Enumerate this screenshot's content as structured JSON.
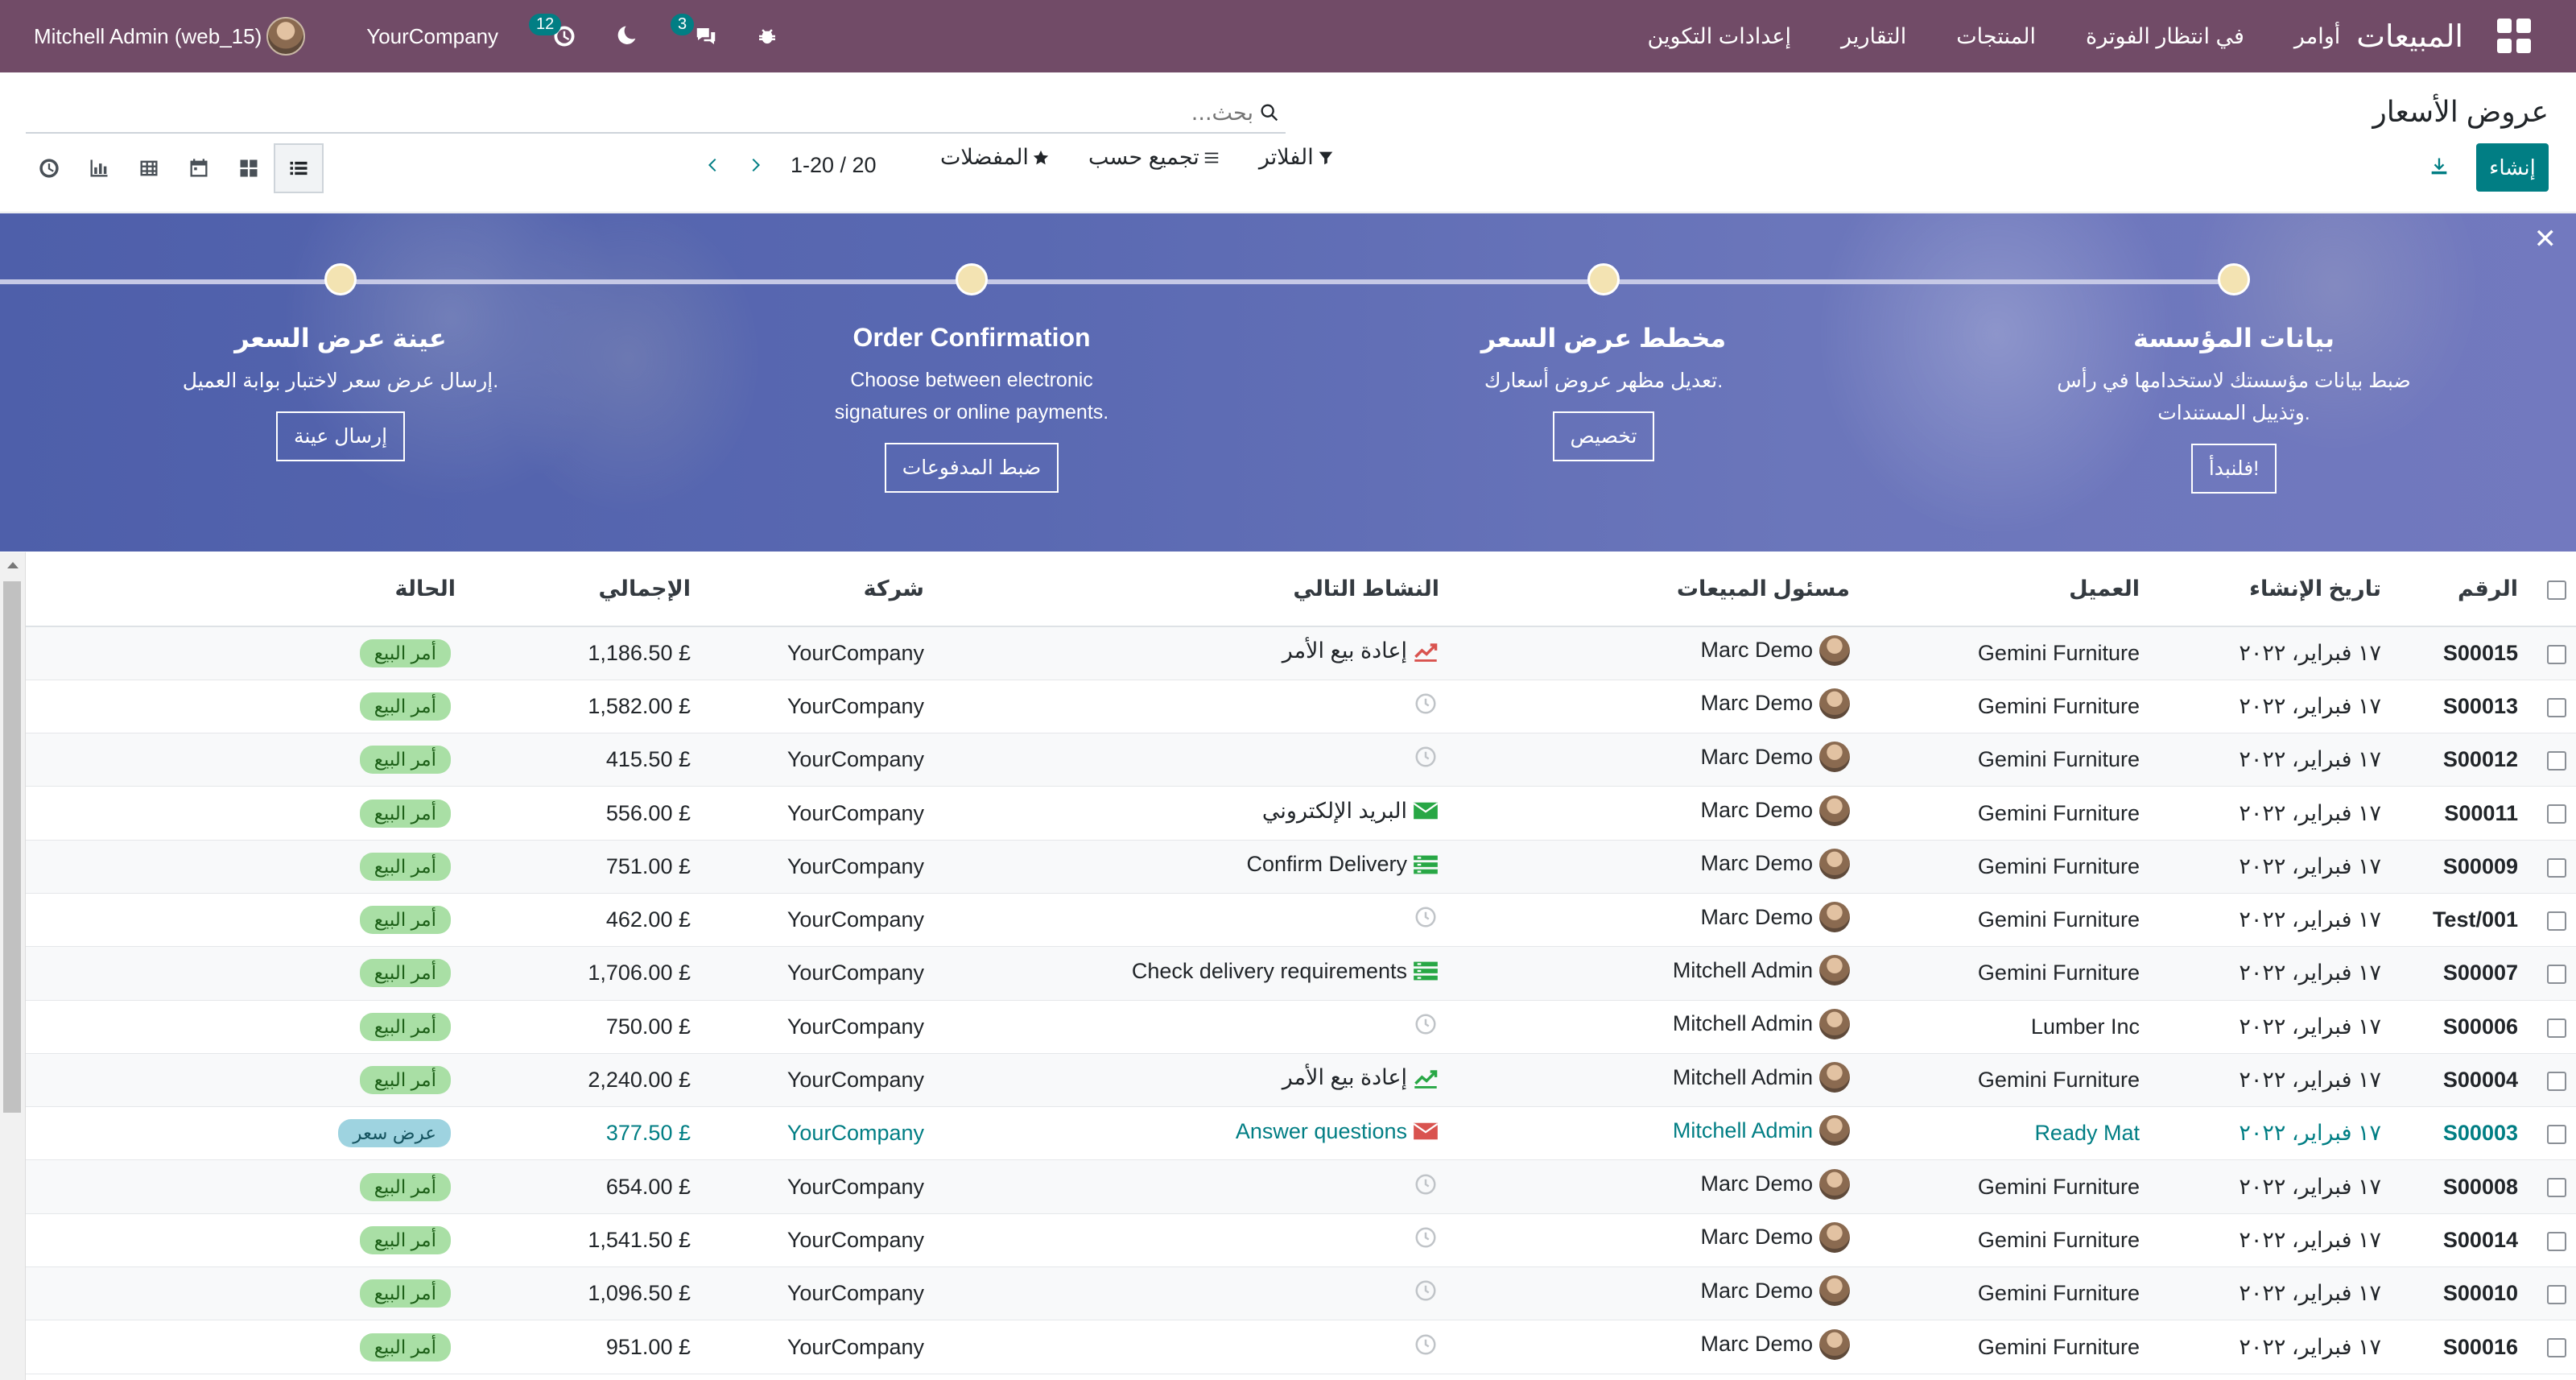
{
  "navbar": {
    "app_name": "المبيعات",
    "menu": [
      "أوامر",
      "في انتظار الفوترة",
      "المنتجات",
      "التقارير",
      "إعدادات التكوين"
    ],
    "user": "Mitchell Admin (web_15)",
    "company": "YourCompany",
    "activity_count": "12",
    "messages_count": "3"
  },
  "control_panel": {
    "title": "عروض الأسعار",
    "search_placeholder": "بحث...",
    "create_label": "إنشاء",
    "filters_label": "الفلاتر",
    "group_by_label": "تجميع حسب",
    "favorites_label": "المفضلات",
    "pager_value": "1-20 / 20"
  },
  "banner": {
    "steps": [
      {
        "title": "بيانات المؤسسة",
        "description": "ضبط بيانات مؤسستك لاستخدامها في رأس وتذييل المستندات.",
        "button": "فلنبدأ!"
      },
      {
        "title": "مخطط عرض السعر",
        "description": "تعديل مظهر عروض أسعارك.",
        "button": "تخصيص"
      },
      {
        "title": "Order Confirmation",
        "description": "Choose between electronic signatures or online payments.",
        "button": "ضبط المدفوعات"
      },
      {
        "title": "عينة عرض السعر",
        "description": "إرسال عرض سعر لاختبار بوابة العميل.",
        "button": "إرسال عينة"
      }
    ]
  },
  "table": {
    "columns": [
      "الرقم",
      "تاريخ الإنشاء",
      "العميل",
      "مسئول المبيعات",
      "النشاط التالي",
      "شركة",
      "الإجمالي",
      "الحالة"
    ],
    "rows": [
      {
        "ref": "S00015",
        "date": "١٧ فبراير، ٢٠٢٢",
        "customer": "Gemini Furniture",
        "salesperson": "Marc Demo",
        "activity": "إعادة بيع الأمر",
        "activity_icon": "upsell-icon",
        "company": "YourCompany",
        "total": "£ 1,186.50",
        "status": "أمر البيع"
      },
      {
        "ref": "S00013",
        "date": "١٧ فبراير، ٢٠٢٢",
        "customer": "Gemini Furniture",
        "salesperson": "Marc Demo",
        "activity": "",
        "activity_icon": "clock-icon",
        "company": "YourCompany",
        "total": "£ 1,582.00",
        "status": "أمر البيع"
      },
      {
        "ref": "S00012",
        "date": "١٧ فبراير، ٢٠٢٢",
        "customer": "Gemini Furniture",
        "salesperson": "Marc Demo",
        "activity": "",
        "activity_icon": "clock-icon",
        "company": "YourCompany",
        "total": "£ 415.50",
        "status": "أمر البيع"
      },
      {
        "ref": "S00011",
        "date": "١٧ فبراير، ٢٠٢٢",
        "customer": "Gemini Furniture",
        "salesperson": "Marc Demo",
        "activity": "البريد الإلكتروني",
        "activity_icon": "email-icon",
        "company": "YourCompany",
        "total": "£ 556.00",
        "status": "أمر البيع"
      },
      {
        "ref": "S00009",
        "date": "١٧ فبراير، ٢٠٢٢",
        "customer": "Gemini Furniture",
        "salesperson": "Marc Demo",
        "activity": "Confirm Delivery",
        "activity_icon": "todo-icon",
        "company": "YourCompany",
        "total": "£ 751.00",
        "status": "أمر البيع"
      },
      {
        "ref": "Test/001",
        "date": "١٧ فبراير، ٢٠٢٢",
        "customer": "Gemini Furniture",
        "salesperson": "Marc Demo",
        "activity": "",
        "activity_icon": "clock-icon",
        "company": "YourCompany",
        "total": "£ 462.00",
        "status": "أمر البيع"
      },
      {
        "ref": "S00007",
        "date": "١٧ فبراير، ٢٠٢٢",
        "customer": "Gemini Furniture",
        "salesperson": "Mitchell Admin",
        "activity": "Check delivery requirements",
        "activity_icon": "todo-icon",
        "company": "YourCompany",
        "total": "£ 1,706.00",
        "status": "أمر البيع"
      },
      {
        "ref": "S00006",
        "date": "١٧ فبراير، ٢٠٢٢",
        "customer": "Lumber Inc",
        "salesperson": "Mitchell Admin",
        "activity": "",
        "activity_icon": "clock-icon",
        "company": "YourCompany",
        "total": "£ 750.00",
        "status": "أمر البيع"
      },
      {
        "ref": "S00004",
        "date": "١٧ فبراير، ٢٠٢٢",
        "customer": "Gemini Furniture",
        "salesperson": "Mitchell Admin",
        "activity": "إعادة بيع الأمر",
        "activity_icon": "upsell-icon-green",
        "company": "YourCompany",
        "total": "£ 2,240.00",
        "status": "أمر البيع"
      },
      {
        "ref": "S00003",
        "date": "١٧ فبراير، ٢٠٢٢",
        "customer": "Ready Mat",
        "salesperson": "Mitchell Admin",
        "activity": "Answer questions",
        "activity_icon": "email-icon-red",
        "company": "YourCompany",
        "total": "£ 377.50",
        "status": "عرض سعر"
      },
      {
        "ref": "S00008",
        "date": "١٧ فبراير، ٢٠٢٢",
        "customer": "Gemini Furniture",
        "salesperson": "Marc Demo",
        "activity": "",
        "activity_icon": "clock-icon",
        "company": "YourCompany",
        "total": "£ 654.00",
        "status": "أمر البيع"
      },
      {
        "ref": "S00014",
        "date": "١٧ فبراير، ٢٠٢٢",
        "customer": "Gemini Furniture",
        "salesperson": "Marc Demo",
        "activity": "",
        "activity_icon": "clock-icon",
        "company": "YourCompany",
        "total": "£ 1,541.50",
        "status": "أمر البيع"
      },
      {
        "ref": "S00010",
        "date": "١٧ فبراير، ٢٠٢٢",
        "customer": "Gemini Furniture",
        "salesperson": "Marc Demo",
        "activity": "",
        "activity_icon": "clock-icon",
        "company": "YourCompany",
        "total": "£ 1,096.50",
        "status": "أمر البيع"
      },
      {
        "ref": "S00016",
        "date": "١٧ فبراير، ٢٠٢٢",
        "customer": "Gemini Furniture",
        "salesperson": "Marc Demo",
        "activity": "",
        "activity_icon": "clock-icon",
        "company": "YourCompany",
        "total": "£ 951.00",
        "status": "أمر البيع"
      }
    ]
  },
  "colors": {
    "navbar": "#714b67",
    "primary": "#017e84",
    "order_badge": "#a9dfa5",
    "quote_badge": "#9ed3e0"
  }
}
